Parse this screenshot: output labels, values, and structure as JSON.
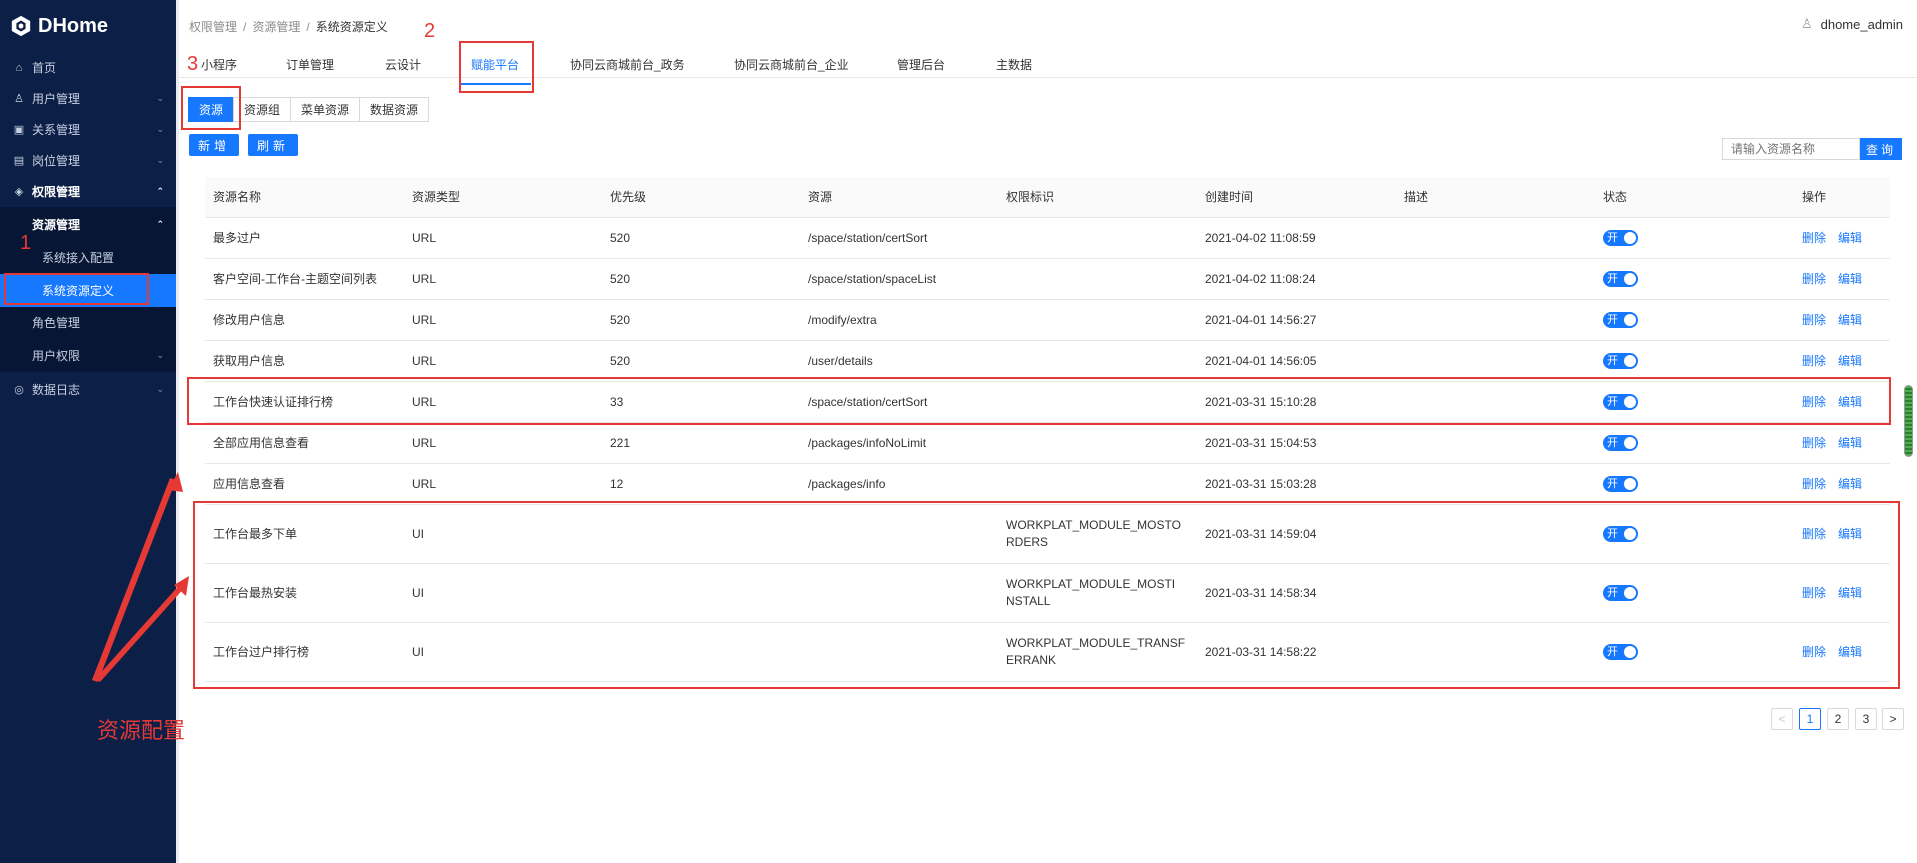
{
  "app": {
    "name": "DHome"
  },
  "sidebar": {
    "items": [
      {
        "label": "首页",
        "icon": "home-icon",
        "glyph": "⌂"
      },
      {
        "label": "用户管理",
        "icon": "user-icon",
        "glyph": "♙"
      },
      {
        "label": "关系管理",
        "icon": "relation-icon",
        "glyph": "▣"
      },
      {
        "label": "岗位管理",
        "icon": "post-icon",
        "glyph": "▤"
      },
      {
        "label": "权限管理",
        "icon": "shield-icon",
        "glyph": "◈"
      },
      {
        "label": "数据日志",
        "icon": "log-icon",
        "glyph": "◎"
      }
    ],
    "sub": {
      "resource_mgmt": "资源管理",
      "sys_access": "系统接入配置",
      "sys_resource_def": "系统资源定义",
      "role_mgmt": "角色管理",
      "user_perm": "用户权限"
    }
  },
  "breadcrumb": [
    "权限管理",
    "资源管理",
    "系统资源定义"
  ],
  "user": {
    "name": "dhome_admin"
  },
  "tabs": [
    "小程序",
    "订单管理",
    "云设计",
    "赋能平台",
    "协同云商城前台_政务",
    "协同云商城前台_企业",
    "管理后台",
    "主数据"
  ],
  "subtabs": [
    "资源",
    "资源组",
    "菜单资源",
    "数据资源"
  ],
  "buttons": {
    "add": "新增",
    "refresh": "刷新",
    "query": "查询"
  },
  "search": {
    "placeholder": "请输入资源名称"
  },
  "table": {
    "headers": [
      "资源名称",
      "资源类型",
      "优先级",
      "资源",
      "权限标识",
      "创建时间",
      "描述",
      "状态",
      "操作"
    ],
    "rows": [
      {
        "name": "最多过户",
        "type": "URL",
        "priority": "520",
        "resource": "/space/station/certSort",
        "perm": "",
        "created": "2021-04-02 11:08:59",
        "desc": "",
        "status": "开"
      },
      {
        "name": "客户空间-工作台-主题空间列表",
        "type": "URL",
        "priority": "520",
        "resource": "/space/station/spaceList",
        "perm": "",
        "created": "2021-04-02 11:08:24",
        "desc": "",
        "status": "开"
      },
      {
        "name": "修改用户信息",
        "type": "URL",
        "priority": "520",
        "resource": "/modify/extra",
        "perm": "",
        "created": "2021-04-01 14:56:27",
        "desc": "",
        "status": "开"
      },
      {
        "name": "获取用户信息",
        "type": "URL",
        "priority": "520",
        "resource": "/user/details",
        "perm": "",
        "created": "2021-04-01 14:56:05",
        "desc": "",
        "status": "开"
      },
      {
        "name": "工作台快速认证排行榜",
        "type": "URL",
        "priority": "33",
        "resource": "/space/station/certSort",
        "perm": "",
        "created": "2021-03-31 15:10:28",
        "desc": "",
        "status": "开"
      },
      {
        "name": "全部应用信息查看",
        "type": "URL",
        "priority": "221",
        "resource": "/packages/infoNoLimit",
        "perm": "",
        "created": "2021-03-31 15:04:53",
        "desc": "",
        "status": "开"
      },
      {
        "name": "应用信息查看",
        "type": "URL",
        "priority": "12",
        "resource": "/packages/info",
        "perm": "",
        "created": "2021-03-31 15:03:28",
        "desc": "",
        "status": "开"
      },
      {
        "name": "工作台最多下单",
        "type": "UI",
        "priority": "",
        "resource": "",
        "perm": "WORKPLAT_MODULE_MOSTORDERS",
        "perm_l1": "WORKPLAT_MODULE_MOSTO",
        "perm_l2": "RDERS",
        "created": "2021-03-31 14:59:04",
        "desc": "",
        "status": "开"
      },
      {
        "name": "工作台最热安装",
        "type": "UI",
        "priority": "",
        "resource": "",
        "perm": "WORKPLAT_MODULE_MOSTINSTALL",
        "perm_l1": "WORKPLAT_MODULE_MOSTI",
        "perm_l2": "NSTALL",
        "created": "2021-03-31 14:58:34",
        "desc": "",
        "status": "开"
      },
      {
        "name": "工作台过户排行榜",
        "type": "UI",
        "priority": "",
        "resource": "",
        "perm": "WORKPLAT_MODULE_TRANSFERRANK",
        "perm_l1": "WORKPLAT_MODULE_TRANSF",
        "perm_l2": "ERRANK",
        "created": "2021-03-31 14:58:22",
        "desc": "",
        "status": "开"
      }
    ],
    "actions": {
      "delete": "删除",
      "edit": "编辑"
    }
  },
  "pagination": {
    "prev": "<",
    "pages": [
      "1",
      "2",
      "3"
    ],
    "next": ">",
    "current": "1"
  },
  "annotations": {
    "num1": "1",
    "num2": "2",
    "num3": "3",
    "label": "资源配置",
    "color": "#e53935"
  },
  "colors": {
    "sidebar_bg": "#0c1f46",
    "primary": "#1677ff",
    "annotation": "#e53935"
  }
}
